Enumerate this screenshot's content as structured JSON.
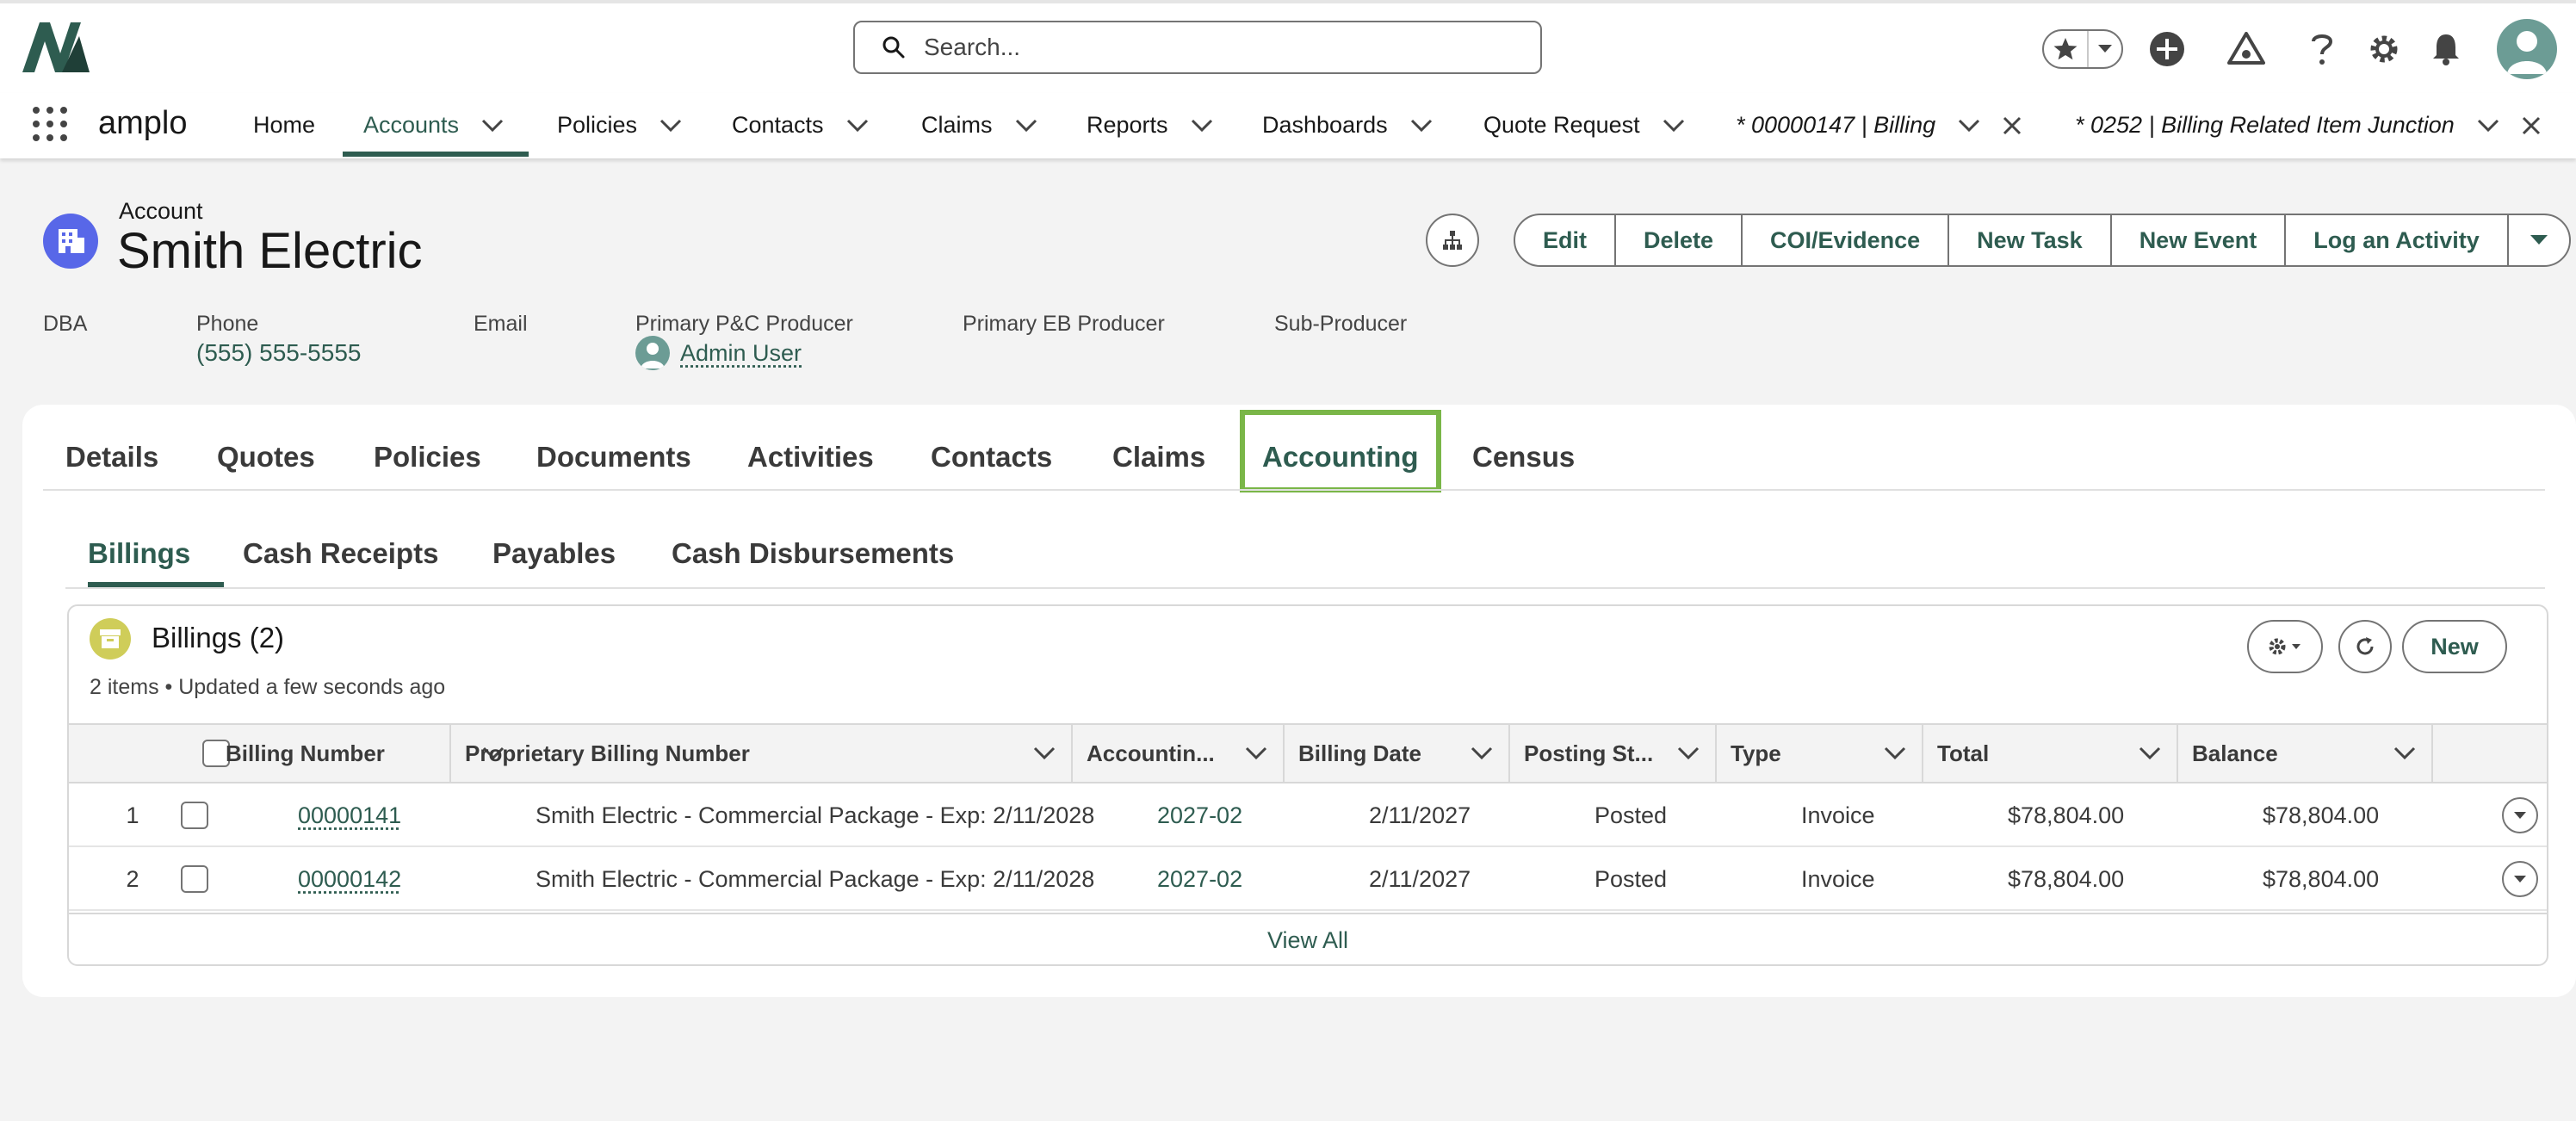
{
  "header": {
    "search_placeholder": "Search...",
    "app_name": "amplo"
  },
  "nav": {
    "items": [
      {
        "label": "Home"
      },
      {
        "label": "Accounts"
      },
      {
        "label": "Policies"
      },
      {
        "label": "Contacts"
      },
      {
        "label": "Claims"
      },
      {
        "label": "Reports"
      },
      {
        "label": "Dashboards"
      },
      {
        "label": "Quote Request"
      }
    ],
    "workspace_tabs": [
      {
        "label": "* 00000147 | Billing"
      },
      {
        "label": "* 0252 | Billing Related Item Junction"
      }
    ]
  },
  "record": {
    "type_label": "Account",
    "name": "Smith Electric",
    "actions": [
      "Edit",
      "Delete",
      "COI/Evidence",
      "New Task",
      "New Event",
      "Log an Activity"
    ],
    "highlights": {
      "dba_label": "DBA",
      "phone_label": "Phone",
      "phone_value": "(555) 555-5555",
      "email_label": "Email",
      "pc_producer_label": "Primary P&C Producer",
      "pc_producer_value": "Admin User",
      "eb_producer_label": "Primary EB Producer",
      "sub_producer_label": "Sub-Producer"
    }
  },
  "tabs": [
    "Details",
    "Quotes",
    "Policies",
    "Documents",
    "Activities",
    "Contacts",
    "Claims",
    "Accounting",
    "Census"
  ],
  "active_tab": "Accounting",
  "subtabs": [
    "Billings",
    "Cash Receipts",
    "Payables",
    "Cash Disbursements"
  ],
  "active_subtab": "Billings",
  "related_list": {
    "title": "Billings (2)",
    "subtitle": "2 items • Updated a few seconds ago",
    "new_label": "New",
    "columns": [
      "Billing Number",
      "Proprietary Billing Number",
      "Accountin...",
      "Billing Date",
      "Posting St...",
      "Type",
      "Total",
      "Balance"
    ],
    "rows": [
      {
        "num": "1",
        "billing_number": "00000141",
        "proprietary": "Smith Electric - Commercial Package - Exp: 2/11/2028",
        "accounting": "2027-02",
        "billing_date": "2/11/2027",
        "posting_status": "Posted",
        "type": "Invoice",
        "total": "$78,804.00",
        "balance": "$78,804.00"
      },
      {
        "num": "2",
        "billing_number": "00000142",
        "proprietary": "Smith Electric - Commercial Package - Exp: 2/11/2028",
        "accounting": "2027-02",
        "billing_date": "2/11/2027",
        "posting_status": "Posted",
        "type": "Invoice",
        "total": "$78,804.00",
        "balance": "$78,804.00"
      }
    ],
    "view_all": "View All"
  },
  "colors": {
    "brand": "#2e5c50",
    "highlight": "#7ab648",
    "account_icon": "#5867e8",
    "billing_icon": "#cfcd59"
  }
}
